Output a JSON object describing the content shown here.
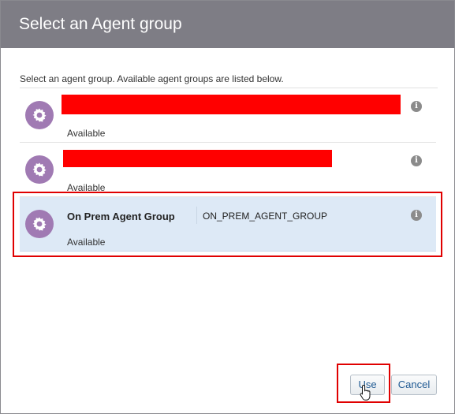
{
  "dialog": {
    "title": "Select an Agent group",
    "instructions": "Select an agent group. Available agent groups are listed below."
  },
  "agent_groups": [
    {
      "name": "",
      "id": "",
      "status": "Available",
      "redacted": true,
      "selected": false
    },
    {
      "name": "",
      "id": "",
      "status": "Available",
      "redacted": true,
      "selected": false
    },
    {
      "name": "On Prem Agent Group",
      "id": "ON_PREM_AGENT_GROUP",
      "status": "Available",
      "redacted": false,
      "selected": true
    }
  ],
  "buttons": {
    "use": "Use",
    "cancel": "Cancel"
  },
  "colors": {
    "header_bg": "#7e7d85",
    "avatar_bg": "#a07ab3",
    "selected_row_bg": "#dde9f6",
    "highlight_border": "#e00000",
    "redaction": "#ff0000"
  },
  "icons": {
    "avatar": "gear-icon",
    "info": "info-icon"
  }
}
